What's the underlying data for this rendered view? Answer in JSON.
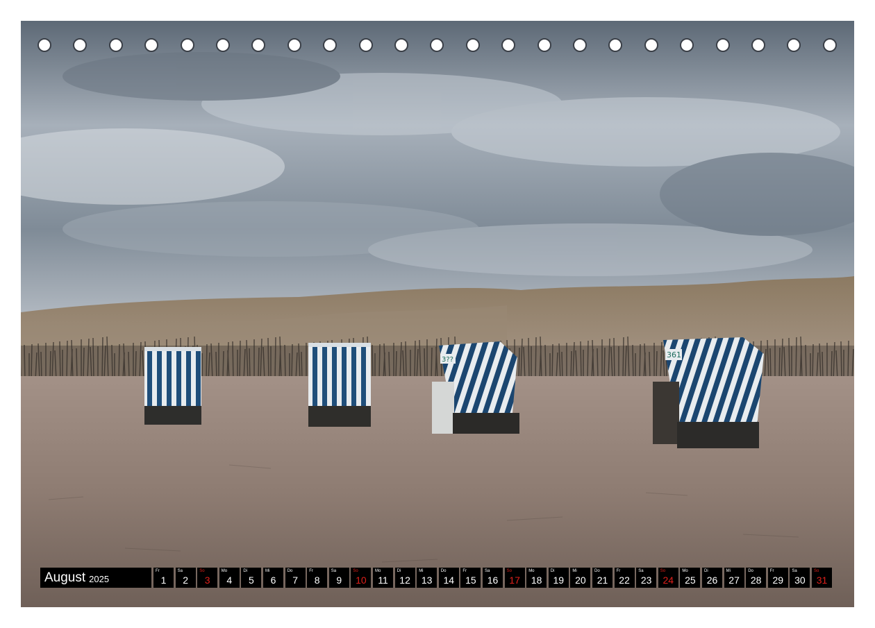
{
  "calendar": {
    "month": "August",
    "year": "2025",
    "days": [
      {
        "wd": "Fr",
        "d": "1"
      },
      {
        "wd": "Sa",
        "d": "2"
      },
      {
        "wd": "So",
        "d": "3",
        "sunday": true
      },
      {
        "wd": "Mo",
        "d": "4"
      },
      {
        "wd": "Di",
        "d": "5"
      },
      {
        "wd": "Mi",
        "d": "6"
      },
      {
        "wd": "Do",
        "d": "7"
      },
      {
        "wd": "Fr",
        "d": "8"
      },
      {
        "wd": "Sa",
        "d": "9"
      },
      {
        "wd": "So",
        "d": "10",
        "sunday": true
      },
      {
        "wd": "Mo",
        "d": "11"
      },
      {
        "wd": "Di",
        "d": "12"
      },
      {
        "wd": "Mi",
        "d": "13"
      },
      {
        "wd": "Do",
        "d": "14"
      },
      {
        "wd": "Fr",
        "d": "15"
      },
      {
        "wd": "Sa",
        "d": "16"
      },
      {
        "wd": "So",
        "d": "17",
        "sunday": true
      },
      {
        "wd": "Mo",
        "d": "18"
      },
      {
        "wd": "Di",
        "d": "19"
      },
      {
        "wd": "Mi",
        "d": "20"
      },
      {
        "wd": "Do",
        "d": "21"
      },
      {
        "wd": "Fr",
        "d": "22"
      },
      {
        "wd": "Sa",
        "d": "23"
      },
      {
        "wd": "So",
        "d": "24",
        "sunday": true
      },
      {
        "wd": "Mo",
        "d": "25"
      },
      {
        "wd": "Di",
        "d": "26"
      },
      {
        "wd": "Mi",
        "d": "27"
      },
      {
        "wd": "Do",
        "d": "28"
      },
      {
        "wd": "Fr",
        "d": "29"
      },
      {
        "wd": "Sa",
        "d": "30"
      },
      {
        "wd": "So",
        "d": "31",
        "sunday": true
      }
    ]
  },
  "colors": {
    "sunday": "#e0201b",
    "stripe_blue": "#1f4e7a",
    "calendar_bg": "#000000"
  },
  "photo": {
    "chair_numbers": [
      "3??",
      "361"
    ]
  }
}
